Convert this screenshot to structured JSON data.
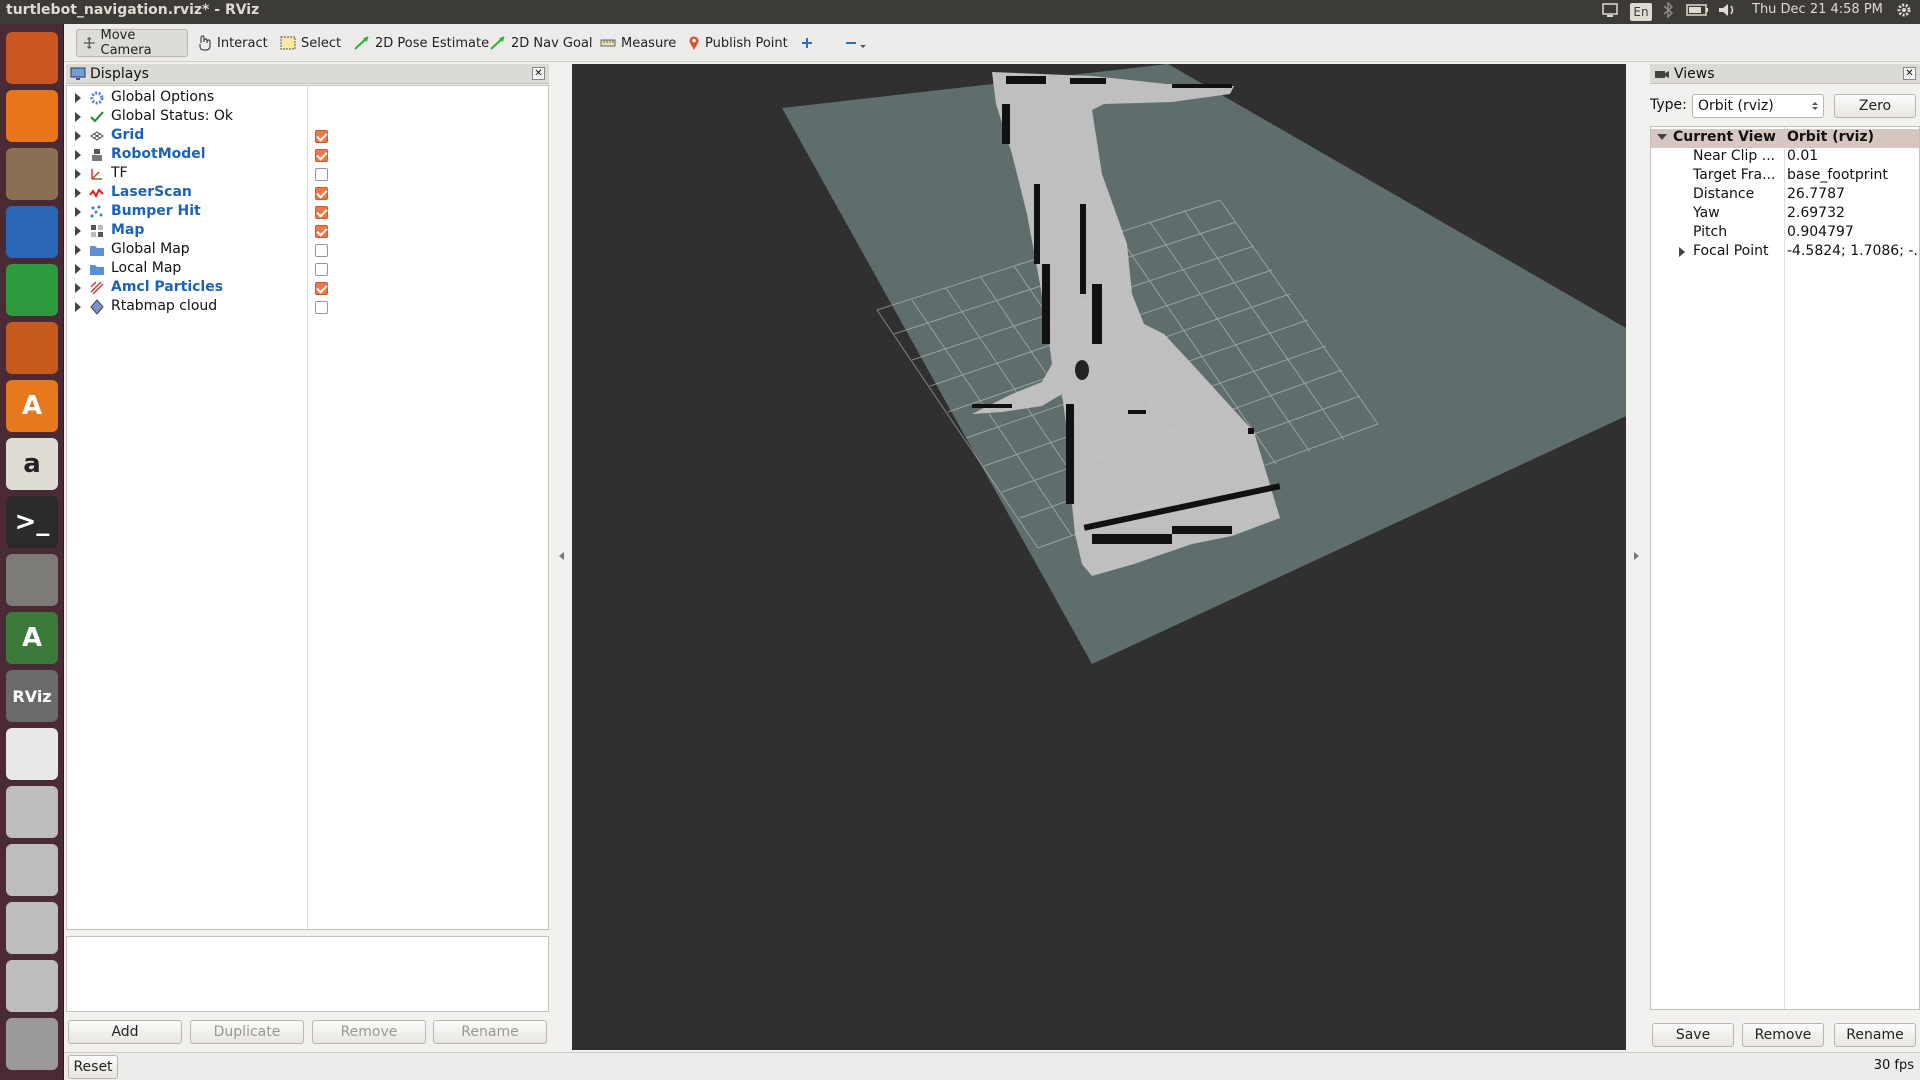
{
  "window": {
    "title": "turtlebot_navigation.rviz* - RViz"
  },
  "top_panel": {
    "language": "En",
    "clock": "Thu Dec 21  4:58 PM"
  },
  "launcher": {
    "items": [
      {
        "name": "ubuntu-dash",
        "color": "#c9571f",
        "glyph": ""
      },
      {
        "name": "firefox",
        "color": "#e8751a",
        "glyph": ""
      },
      {
        "name": "files",
        "color": "#8a6f52",
        "glyph": ""
      },
      {
        "name": "writer",
        "color": "#2967b6",
        "glyph": ""
      },
      {
        "name": "calc",
        "color": "#2c9a3d",
        "glyph": ""
      },
      {
        "name": "impress",
        "color": "#c65b1d",
        "glyph": ""
      },
      {
        "name": "software",
        "color": "#e6781e",
        "glyph": "A"
      },
      {
        "name": "amazon",
        "color": "#e0dcd4",
        "glyph": "a"
      },
      {
        "name": "terminal",
        "color": "#2b2b2b",
        "glyph": ">_"
      },
      {
        "name": "settings",
        "color": "#7c7b78",
        "glyph": ""
      },
      {
        "name": "updater",
        "color": "#3b7a3a",
        "glyph": "A"
      },
      {
        "name": "rviz",
        "color": "#6b6b6b",
        "glyph": "RViz"
      },
      {
        "name": "chrome",
        "color": "#e8e8e8",
        "glyph": ""
      },
      {
        "name": "drive-1",
        "color": "#bdbdbd",
        "glyph": ""
      },
      {
        "name": "drive-2",
        "color": "#bdbdbd",
        "glyph": ""
      },
      {
        "name": "drive-3",
        "color": "#bdbdbd",
        "glyph": ""
      },
      {
        "name": "drive-4",
        "color": "#bdbdbd",
        "glyph": ""
      },
      {
        "name": "trash",
        "color": "#9a9a9a",
        "glyph": ""
      }
    ]
  },
  "toolbar": {
    "move_camera": "Move Camera",
    "interact": "Interact",
    "select": "Select",
    "pose_estimate": "2D Pose Estimate",
    "nav_goal": "2D Nav Goal",
    "measure": "Measure",
    "publish_point": "Publish Point"
  },
  "displays": {
    "title": "Displays",
    "items": [
      {
        "label": "Global Options",
        "bold": false,
        "checkbox": null,
        "icon": "gear-icon"
      },
      {
        "label": "Global Status: Ok",
        "bold": false,
        "checkbox": null,
        "icon": "check-icon"
      },
      {
        "label": "Grid",
        "bold": true,
        "checkbox": true,
        "icon": "grid-icon"
      },
      {
        "label": "RobotModel",
        "bold": true,
        "checkbox": true,
        "icon": "robot-icon"
      },
      {
        "label": "TF",
        "bold": false,
        "checkbox": false,
        "icon": "axes-icon"
      },
      {
        "label": "LaserScan",
        "bold": true,
        "checkbox": true,
        "icon": "laser-icon"
      },
      {
        "label": "Bumper Hit",
        "bold": true,
        "checkbox": true,
        "icon": "points-icon"
      },
      {
        "label": "Map",
        "bold": true,
        "checkbox": true,
        "icon": "map-icon"
      },
      {
        "label": "Global Map",
        "bold": false,
        "checkbox": false,
        "icon": "folder-icon"
      },
      {
        "label": "Local Map",
        "bold": false,
        "checkbox": false,
        "icon": "folder-icon"
      },
      {
        "label": "Amcl Particles",
        "bold": true,
        "checkbox": true,
        "icon": "particles-icon"
      },
      {
        "label": "Rtabmap cloud",
        "bold": false,
        "checkbox": false,
        "icon": "cloud-icon"
      }
    ],
    "buttons": {
      "add": "Add",
      "duplicate": "Duplicate",
      "remove": "Remove",
      "rename": "Rename"
    }
  },
  "views": {
    "title": "Views",
    "type_label": "Type:",
    "type_value": "Orbit (rviz)",
    "zero": "Zero",
    "header": {
      "key": "Current View",
      "value": "Orbit (rviz)"
    },
    "rows": [
      {
        "key": "Near Clip ...",
        "value": "0.01"
      },
      {
        "key": "Target Fra...",
        "value": "base_footprint"
      },
      {
        "key": "Distance",
        "value": "26.7787"
      },
      {
        "key": "Yaw",
        "value": "2.69732"
      },
      {
        "key": "Pitch",
        "value": "0.904797"
      },
      {
        "key": "Focal Point",
        "value": "-4.5824; 1.7086; -..."
      }
    ],
    "buttons": {
      "save": "Save",
      "remove": "Remove",
      "rename": "Rename"
    }
  },
  "status": {
    "reset": "Reset",
    "fps": "30 fps"
  },
  "colors": {
    "map_free": "#bfbfbf",
    "map_unknown": "#5f6e6d",
    "viewport_bg": "#303030",
    "checkbox_on": "#f07746"
  }
}
